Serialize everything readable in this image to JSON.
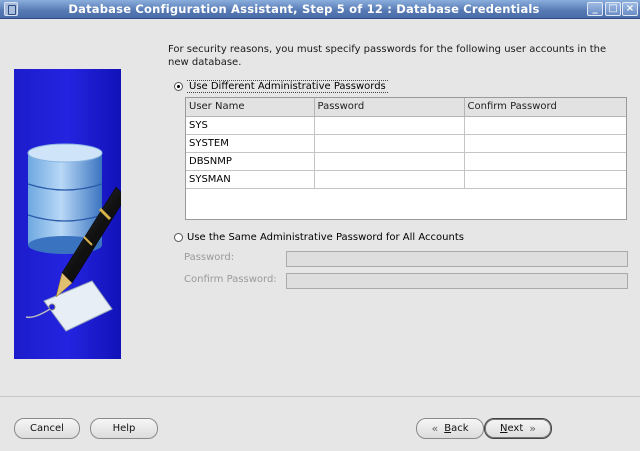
{
  "window": {
    "title": "Database Configuration Assistant, Step 5 of 12 : Database Credentials",
    "minimize_glyph": "_",
    "maximize_glyph": "□",
    "close_glyph": "×"
  },
  "intro_text": "For security reasons, you must specify passwords for the following user accounts in the new database.",
  "option_different": {
    "label": "Use Different Administrative Passwords",
    "selected": true
  },
  "grid": {
    "headers": [
      "User Name",
      "Password",
      "Confirm Password"
    ],
    "rows": [
      {
        "user": "SYS",
        "password": "",
        "confirm": ""
      },
      {
        "user": "SYSTEM",
        "password": "",
        "confirm": ""
      },
      {
        "user": "DBSNMP",
        "password": "",
        "confirm": ""
      },
      {
        "user": "SYSMAN",
        "password": "",
        "confirm": ""
      }
    ]
  },
  "option_same": {
    "label": "Use the Same Administrative Password for All Accounts",
    "selected": false,
    "password_label": "Password:",
    "confirm_label": "Confirm Password:"
  },
  "buttons": {
    "cancel": "Cancel",
    "help": "Help",
    "back_mnemonic": "B",
    "back_rest": "ack",
    "next_mnemonic": "N",
    "next_rest": "ext"
  },
  "icons": {
    "back": "double-chevron-left-icon",
    "next": "double-chevron-right-icon"
  },
  "colors": {
    "titlebar": "#5679b4",
    "art_background": "#2020d8"
  }
}
